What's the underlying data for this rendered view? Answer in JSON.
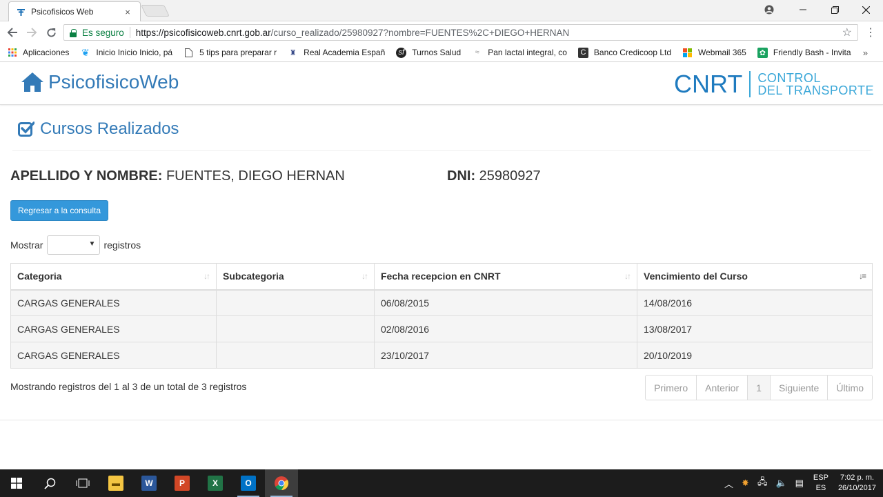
{
  "browser": {
    "tab_title": "Psicofisicos Web",
    "tab_close": "×",
    "secure_label": "Es seguro",
    "url_host": "https://psicofisicoweb.cnrt.gob.ar",
    "url_path": "/curso_realizado/25980927?nombre=FUENTES%2C+DIEGO+HERNAN",
    "bookmarks": [
      {
        "label": "Aplicaciones",
        "icon": "apps-icon"
      },
      {
        "label": "Inicio Inicio Inicio, pá",
        "icon": "twitter-icon"
      },
      {
        "label": "5 tips para preparar r",
        "icon": "document-icon"
      },
      {
        "label": "Real Academia Españ",
        "icon": "rae-icon"
      },
      {
        "label": "Turnos Salud",
        "icon": "symfony-icon"
      },
      {
        "label": "Pan lactal integral, co",
        "icon": "recipe-icon"
      },
      {
        "label": "Banco Credicoop Ltd",
        "icon": "bank-icon"
      },
      {
        "label": "Webmail 365",
        "icon": "microsoft-icon"
      },
      {
        "label": "Friendly Bash - Invita",
        "icon": "party-icon"
      }
    ],
    "more_bookmarks": "»"
  },
  "site": {
    "brand": "PsicofisicoWeb",
    "logo_big": "CNRT",
    "logo_line1": "CONTROL",
    "logo_line2": "DEL TRANSPORTE"
  },
  "section": {
    "title": "Cursos Realizados",
    "name_label": "APELLIDO Y NOMBRE:",
    "name_value": "FUENTES, DIEGO HERNAN",
    "dni_label": "DNI:",
    "dni_value": "25980927",
    "back_button": "Regresar a la consulta",
    "show_label": "Mostrar",
    "records_label": "registros"
  },
  "table": {
    "headers": [
      "Categoria",
      "Subcategoria",
      "Fecha recepcion en CNRT",
      "Vencimiento del Curso"
    ],
    "rows": [
      [
        "CARGAS GENERALES",
        "",
        "06/08/2015",
        "14/08/2016"
      ],
      [
        "CARGAS GENERALES",
        "",
        "02/08/2016",
        "13/08/2017"
      ],
      [
        "CARGAS GENERALES",
        "",
        "23/10/2017",
        "20/10/2019"
      ]
    ],
    "info": "Mostrando registros del 1 al 3 de un total de 3 registros",
    "pager": {
      "first": "Primero",
      "prev": "Anterior",
      "current": "1",
      "next": "Siguiente",
      "last": "Último"
    }
  },
  "taskbar": {
    "lang_line1": "ESP",
    "lang_line2": "ES",
    "time": "7:02 p. m.",
    "date": "26/10/2017"
  },
  "colors": {
    "primary": "#337ab7",
    "button": "#3498db",
    "secure": "#0b8043",
    "cnrt": "#1f7bbf"
  }
}
